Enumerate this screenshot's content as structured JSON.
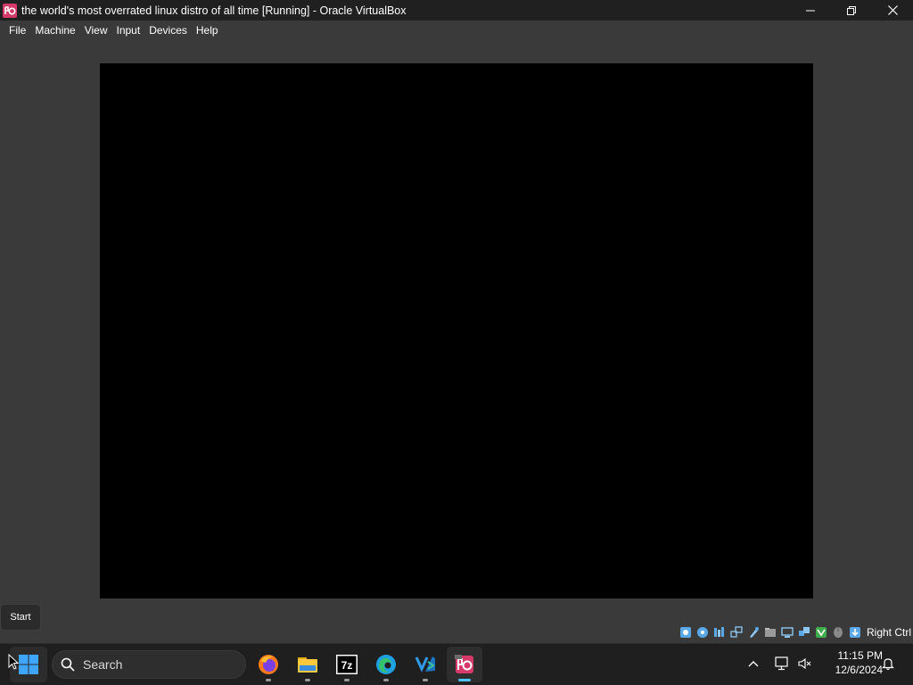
{
  "window": {
    "title": "the world's most overrated linux distro of all time [Running] - Oracle VirtualBox",
    "app_icon": "virtualbox-vm-icon",
    "controls": [
      "minimize-icon",
      "restore-icon",
      "close-icon"
    ]
  },
  "menubar": {
    "items": [
      "File",
      "Machine",
      "View",
      "Input",
      "Devices",
      "Help"
    ]
  },
  "vm": {
    "screen_color": "#000000"
  },
  "statusbar": {
    "icons": [
      "hard-disk-icon",
      "optical-drive-icon",
      "audio-icon",
      "network-icon",
      "usb-icon",
      "shared-folder-icon",
      "display-icon",
      "recording-icon",
      "virtualization-icon",
      "mouse-integration-icon",
      "keyboard-icon"
    ],
    "host_key": "Right Ctrl"
  },
  "tooltip": {
    "text": "Start"
  },
  "taskbar": {
    "search_placeholder": "Search",
    "apps": [
      "firefox",
      "file-explorer",
      "7zip",
      "edge",
      "vscode",
      "virtualbox"
    ],
    "sevenzip_label": "7z",
    "time": "11:15 PM",
    "date": "12/6/2024"
  },
  "colors": {
    "accent": "#4cc2ff",
    "titlebar": "#202020",
    "background": "#3a3a3a",
    "taskbar": "#1f1f1f"
  }
}
